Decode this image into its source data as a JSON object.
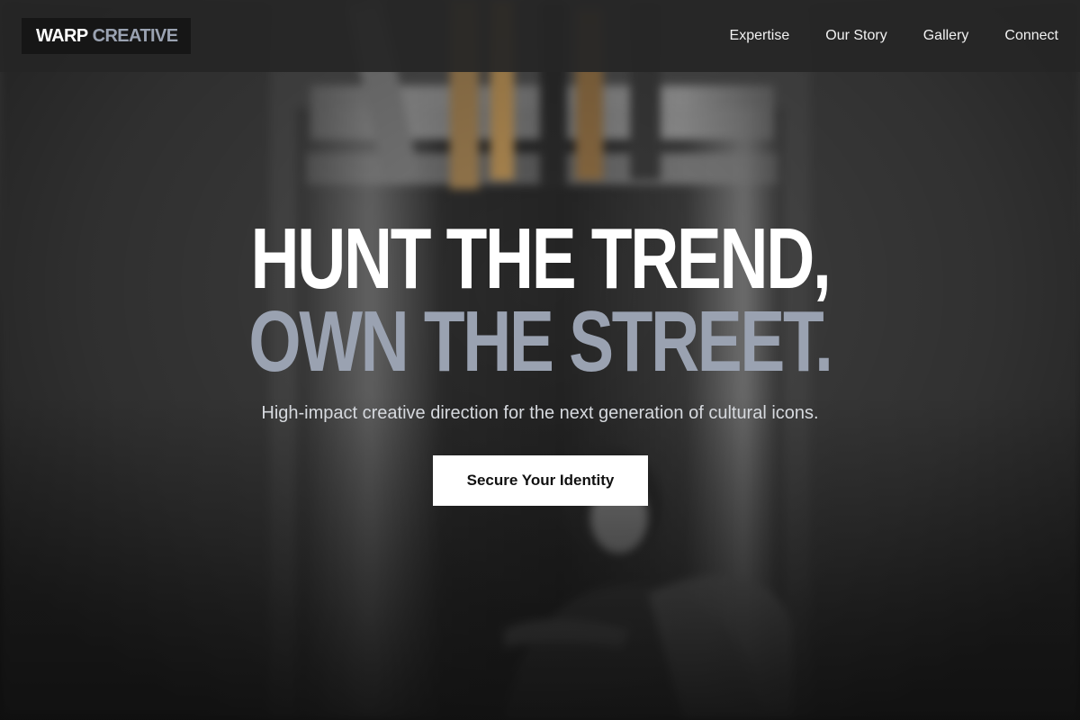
{
  "brand": {
    "logo_part1": "WARP",
    "logo_part2": "CREATIVE"
  },
  "nav": {
    "items": [
      {
        "label": "Expertise"
      },
      {
        "label": "Our Story"
      },
      {
        "label": "Gallery"
      },
      {
        "label": "Connect"
      }
    ]
  },
  "hero": {
    "headline_line1": "HUNT THE TREND,",
    "headline_line2": "OWN THE STREET.",
    "subheadline": "High-impact creative direction for the next generation of cultural icons.",
    "cta_label": "Secure Your Identity"
  },
  "colors": {
    "header_bg": "#262626",
    "logo_bg": "#161616",
    "accent_gray_blue": "#9aa2b1",
    "headline_white": "#ffffff",
    "cta_bg": "#ffffff",
    "cta_text": "#111111"
  }
}
